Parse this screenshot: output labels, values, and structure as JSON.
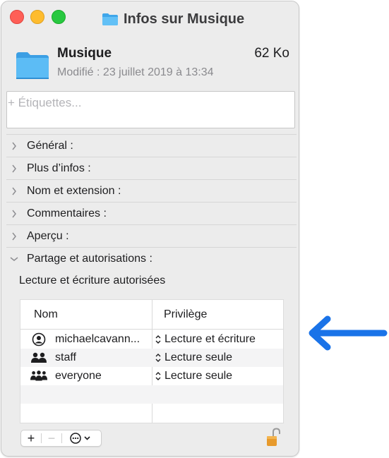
{
  "window": {
    "title": "Infos sur Musique",
    "title_icon": "folder-icon"
  },
  "file": {
    "name": "Musique",
    "size": "62 Ko",
    "modified": "Modifié : 23 juillet 2019 à 13:34",
    "icon": "folder-icon"
  },
  "tags": {
    "placeholder": "+ Étiquettes..."
  },
  "sections": [
    {
      "label": "Général :",
      "expanded": false
    },
    {
      "label": "Plus d’infos :",
      "expanded": false
    },
    {
      "label": "Nom et extension :",
      "expanded": false
    },
    {
      "label": "Commentaires :",
      "expanded": false
    },
    {
      "label": "Aperçu :",
      "expanded": false
    },
    {
      "label": "Partage et autorisations :",
      "expanded": true
    }
  ],
  "permissions": {
    "caption": "Lecture et écriture autorisées",
    "columns": {
      "name": "Nom",
      "privilege": "Privilège"
    },
    "rows": [
      {
        "name": "michaelcavann...",
        "icon": "user-icon",
        "privilege": "Lecture et écriture"
      },
      {
        "name": "staff",
        "icon": "group-icon",
        "privilege": "Lecture seule"
      },
      {
        "name": "everyone",
        "icon": "everyone-icon",
        "privilege": "Lecture seule"
      }
    ]
  },
  "toolbar": {
    "add_label": "+",
    "remove_label": "−",
    "action_icon": "ellipsis-circle-icon"
  },
  "colors": {
    "arrow": "#1a73e8",
    "folder": "#4fb3f0",
    "close": "#fe5f57",
    "minimize": "#febc2e",
    "maximize": "#28c840",
    "lock": "#e79a2c"
  }
}
